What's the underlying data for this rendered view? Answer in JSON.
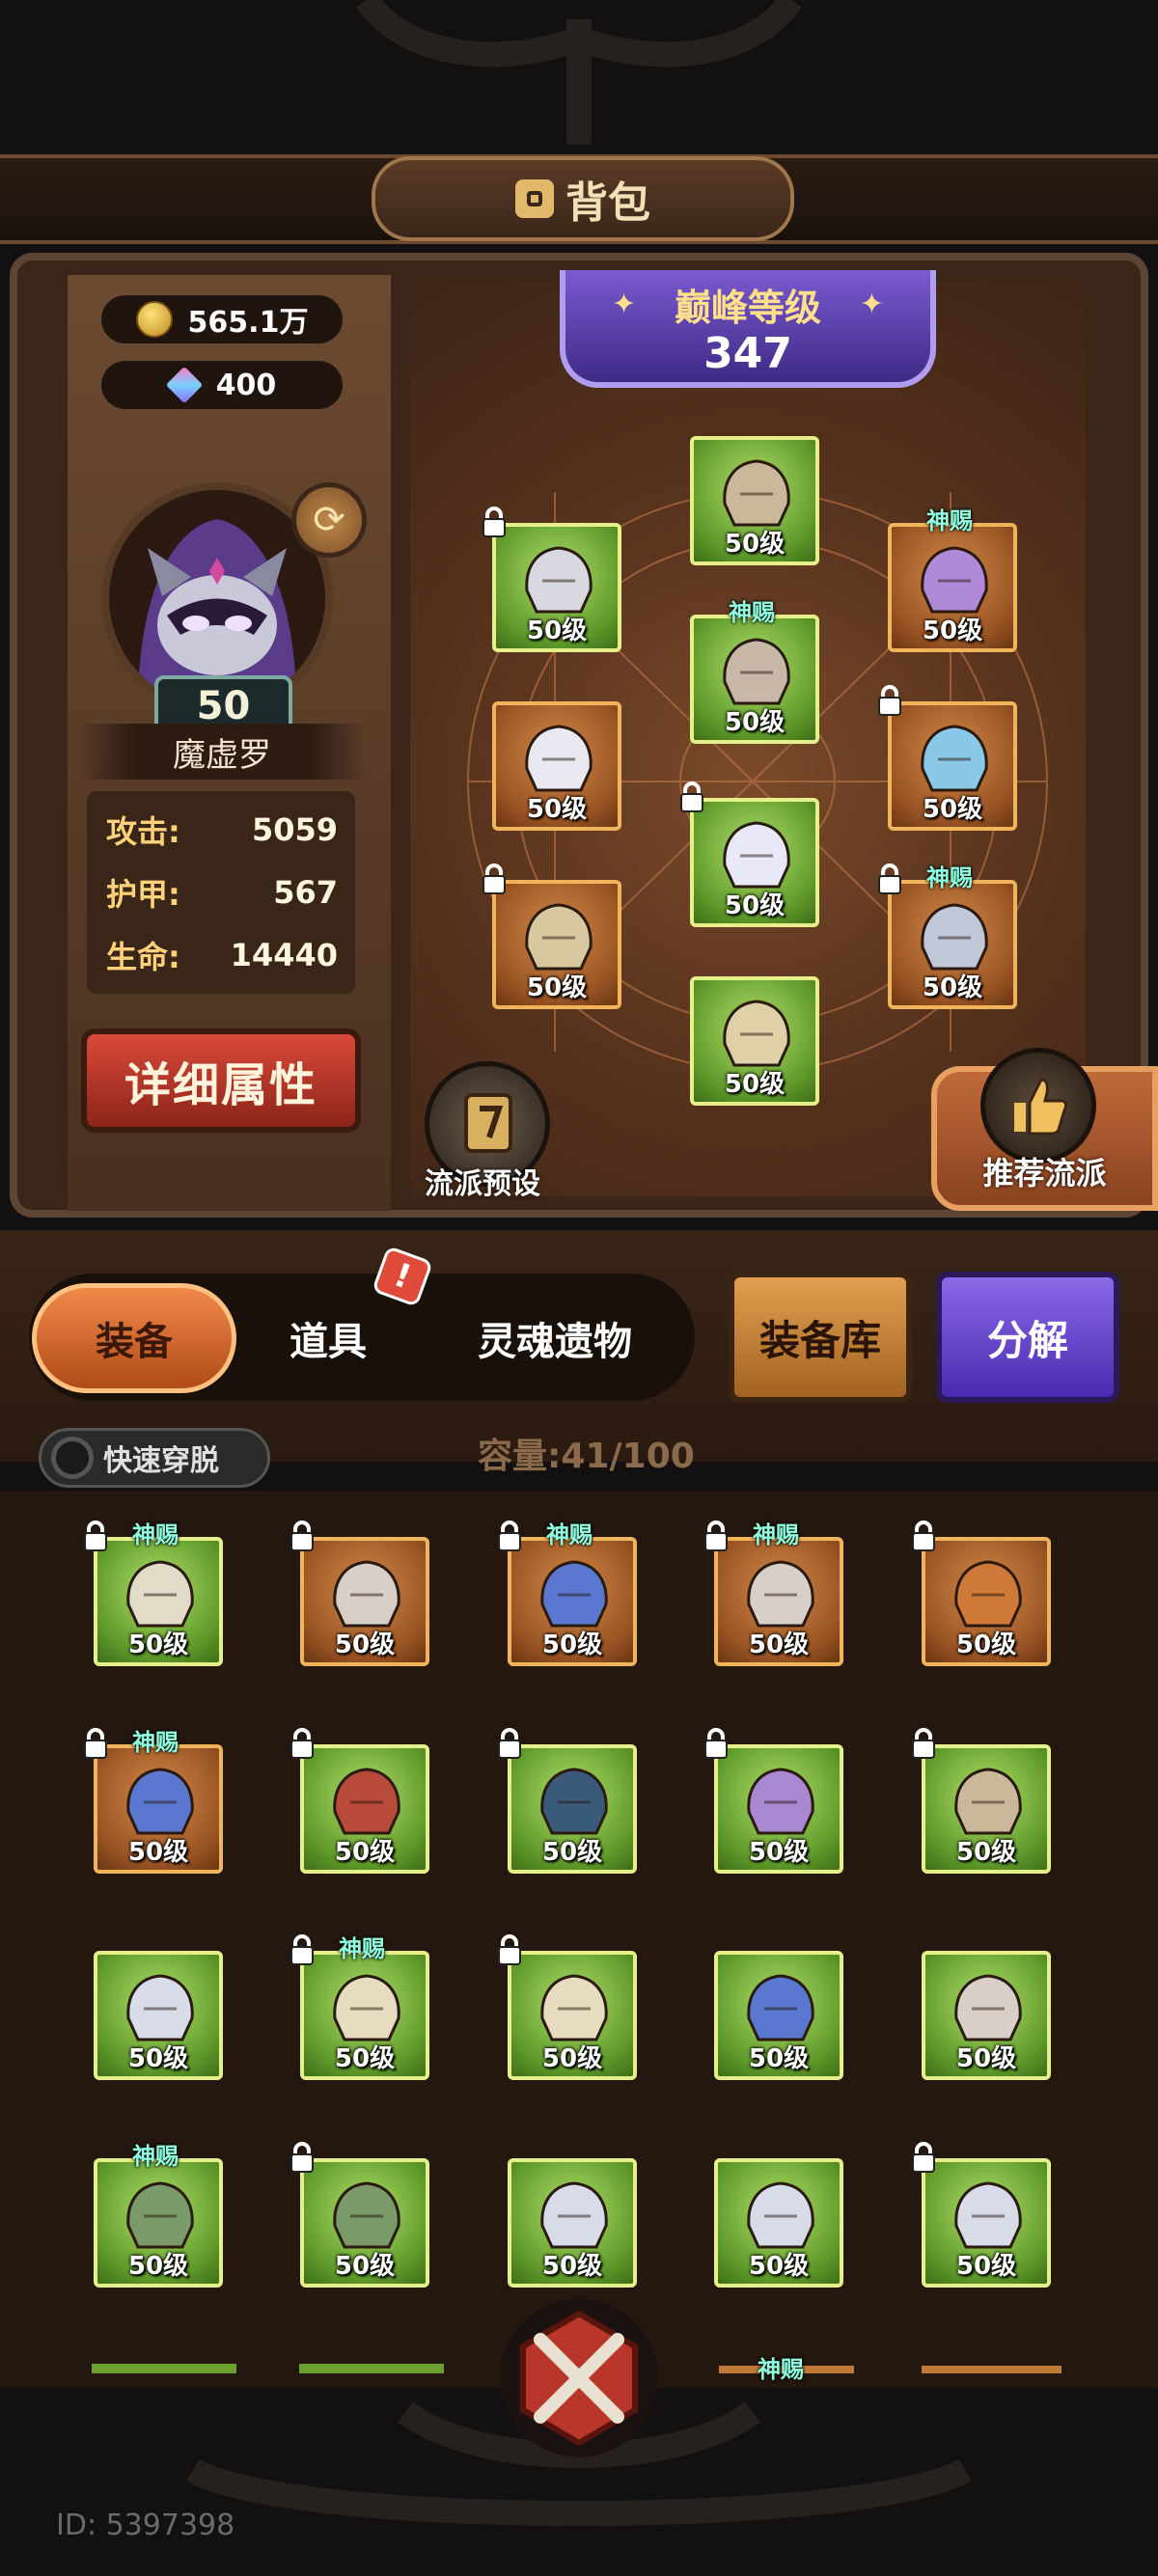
{
  "header": {
    "title": "背包"
  },
  "currency": {
    "gold": "565.1万",
    "gems": "400"
  },
  "hero": {
    "level": "50",
    "name": "魔虚罗"
  },
  "stats": [
    {
      "label": "攻击:",
      "value": "5059"
    },
    {
      "label": "护甲:",
      "value": "567"
    },
    {
      "label": "生命:",
      "value": "14440"
    }
  ],
  "detail_button": "详细属性",
  "peak": {
    "label": "巅峰等级",
    "value": "347"
  },
  "equipped": [
    {
      "slot": "head",
      "level": "50级",
      "rarity": "green",
      "locked": false,
      "tag": ""
    },
    {
      "slot": "shoulder",
      "level": "50级",
      "rarity": "green",
      "locked": true,
      "tag": ""
    },
    {
      "slot": "necklace",
      "level": "50级",
      "rarity": "orange",
      "locked": false,
      "tag": "神赐"
    },
    {
      "slot": "body",
      "level": "50级",
      "rarity": "green",
      "locked": false,
      "tag": "神赐"
    },
    {
      "slot": "gloves",
      "level": "50级",
      "rarity": "orange",
      "locked": false,
      "tag": ""
    },
    {
      "slot": "ring",
      "level": "50级",
      "rarity": "orange",
      "locked": true,
      "tag": ""
    },
    {
      "slot": "legs",
      "level": "50级",
      "rarity": "green",
      "locked": true,
      "tag": ""
    },
    {
      "slot": "weapon",
      "level": "50级",
      "rarity": "orange",
      "locked": true,
      "tag": ""
    },
    {
      "slot": "offhand",
      "level": "50级",
      "rarity": "orange",
      "locked": true,
      "tag": "神赐"
    },
    {
      "slot": "boots",
      "level": "50级",
      "rarity": "green",
      "locked": false,
      "tag": ""
    }
  ],
  "school_preset": "流派预设",
  "recommend_school": "推荐流派",
  "tabs": [
    "装备",
    "道具",
    "灵魂遗物"
  ],
  "alert_mark": "!",
  "armory_button": "装备库",
  "decompose_button": "分解",
  "quick_toggle": "快速穿脱",
  "capacity": {
    "label": "容量:",
    "value": "41/100"
  },
  "inventory": [
    {
      "item": "eagle-helm",
      "level": "50级",
      "rarity": "green",
      "locked": true,
      "tag": "神赐"
    },
    {
      "item": "bow-bracer",
      "level": "50级",
      "rarity": "orange",
      "locked": true,
      "tag": ""
    },
    {
      "item": "blue-hood",
      "level": "50级",
      "rarity": "orange",
      "locked": true,
      "tag": "神赐"
    },
    {
      "item": "hooded-mask",
      "level": "50级",
      "rarity": "orange",
      "locked": true,
      "tag": "神赐"
    },
    {
      "item": "amber-amulet",
      "level": "50级",
      "rarity": "orange",
      "locked": true,
      "tag": ""
    },
    {
      "item": "sapphire-ring",
      "level": "50级",
      "rarity": "orange",
      "locked": true,
      "tag": "神赐"
    },
    {
      "item": "red-chest",
      "level": "50级",
      "rarity": "green",
      "locked": true,
      "tag": ""
    },
    {
      "item": "studded-vest",
      "level": "50级",
      "rarity": "green",
      "locked": true,
      "tag": ""
    },
    {
      "item": "purple-robe",
      "level": "50级",
      "rarity": "green",
      "locked": true,
      "tag": ""
    },
    {
      "item": "stone-helm",
      "level": "50级",
      "rarity": "green",
      "locked": true,
      "tag": ""
    },
    {
      "item": "steel-gauntlet",
      "level": "50级",
      "rarity": "green",
      "locked": false,
      "tag": ""
    },
    {
      "item": "gold-greaves",
      "level": "50级",
      "rarity": "green",
      "locked": true,
      "tag": "神赐"
    },
    {
      "item": "gold-greaves-2",
      "level": "50级",
      "rarity": "green",
      "locked": true,
      "tag": ""
    },
    {
      "item": "winged-boots",
      "level": "50级",
      "rarity": "green",
      "locked": false,
      "tag": ""
    },
    {
      "item": "plated-boots",
      "level": "50级",
      "rarity": "green",
      "locked": false,
      "tag": ""
    },
    {
      "item": "green-helm",
      "level": "50级",
      "rarity": "green",
      "locked": false,
      "tag": "神赐"
    },
    {
      "item": "green-helm-2",
      "level": "50级",
      "rarity": "green",
      "locked": true,
      "tag": ""
    },
    {
      "item": "winged-pauldron",
      "level": "50级",
      "rarity": "green",
      "locked": false,
      "tag": ""
    },
    {
      "item": "winged-pauldron-2",
      "level": "50级",
      "rarity": "green",
      "locked": false,
      "tag": ""
    },
    {
      "item": "iron-kettle-helm",
      "level": "50级",
      "rarity": "green",
      "locked": true,
      "tag": ""
    }
  ],
  "partial_row_tag": "神赐",
  "user_id": "ID: 5397398"
}
